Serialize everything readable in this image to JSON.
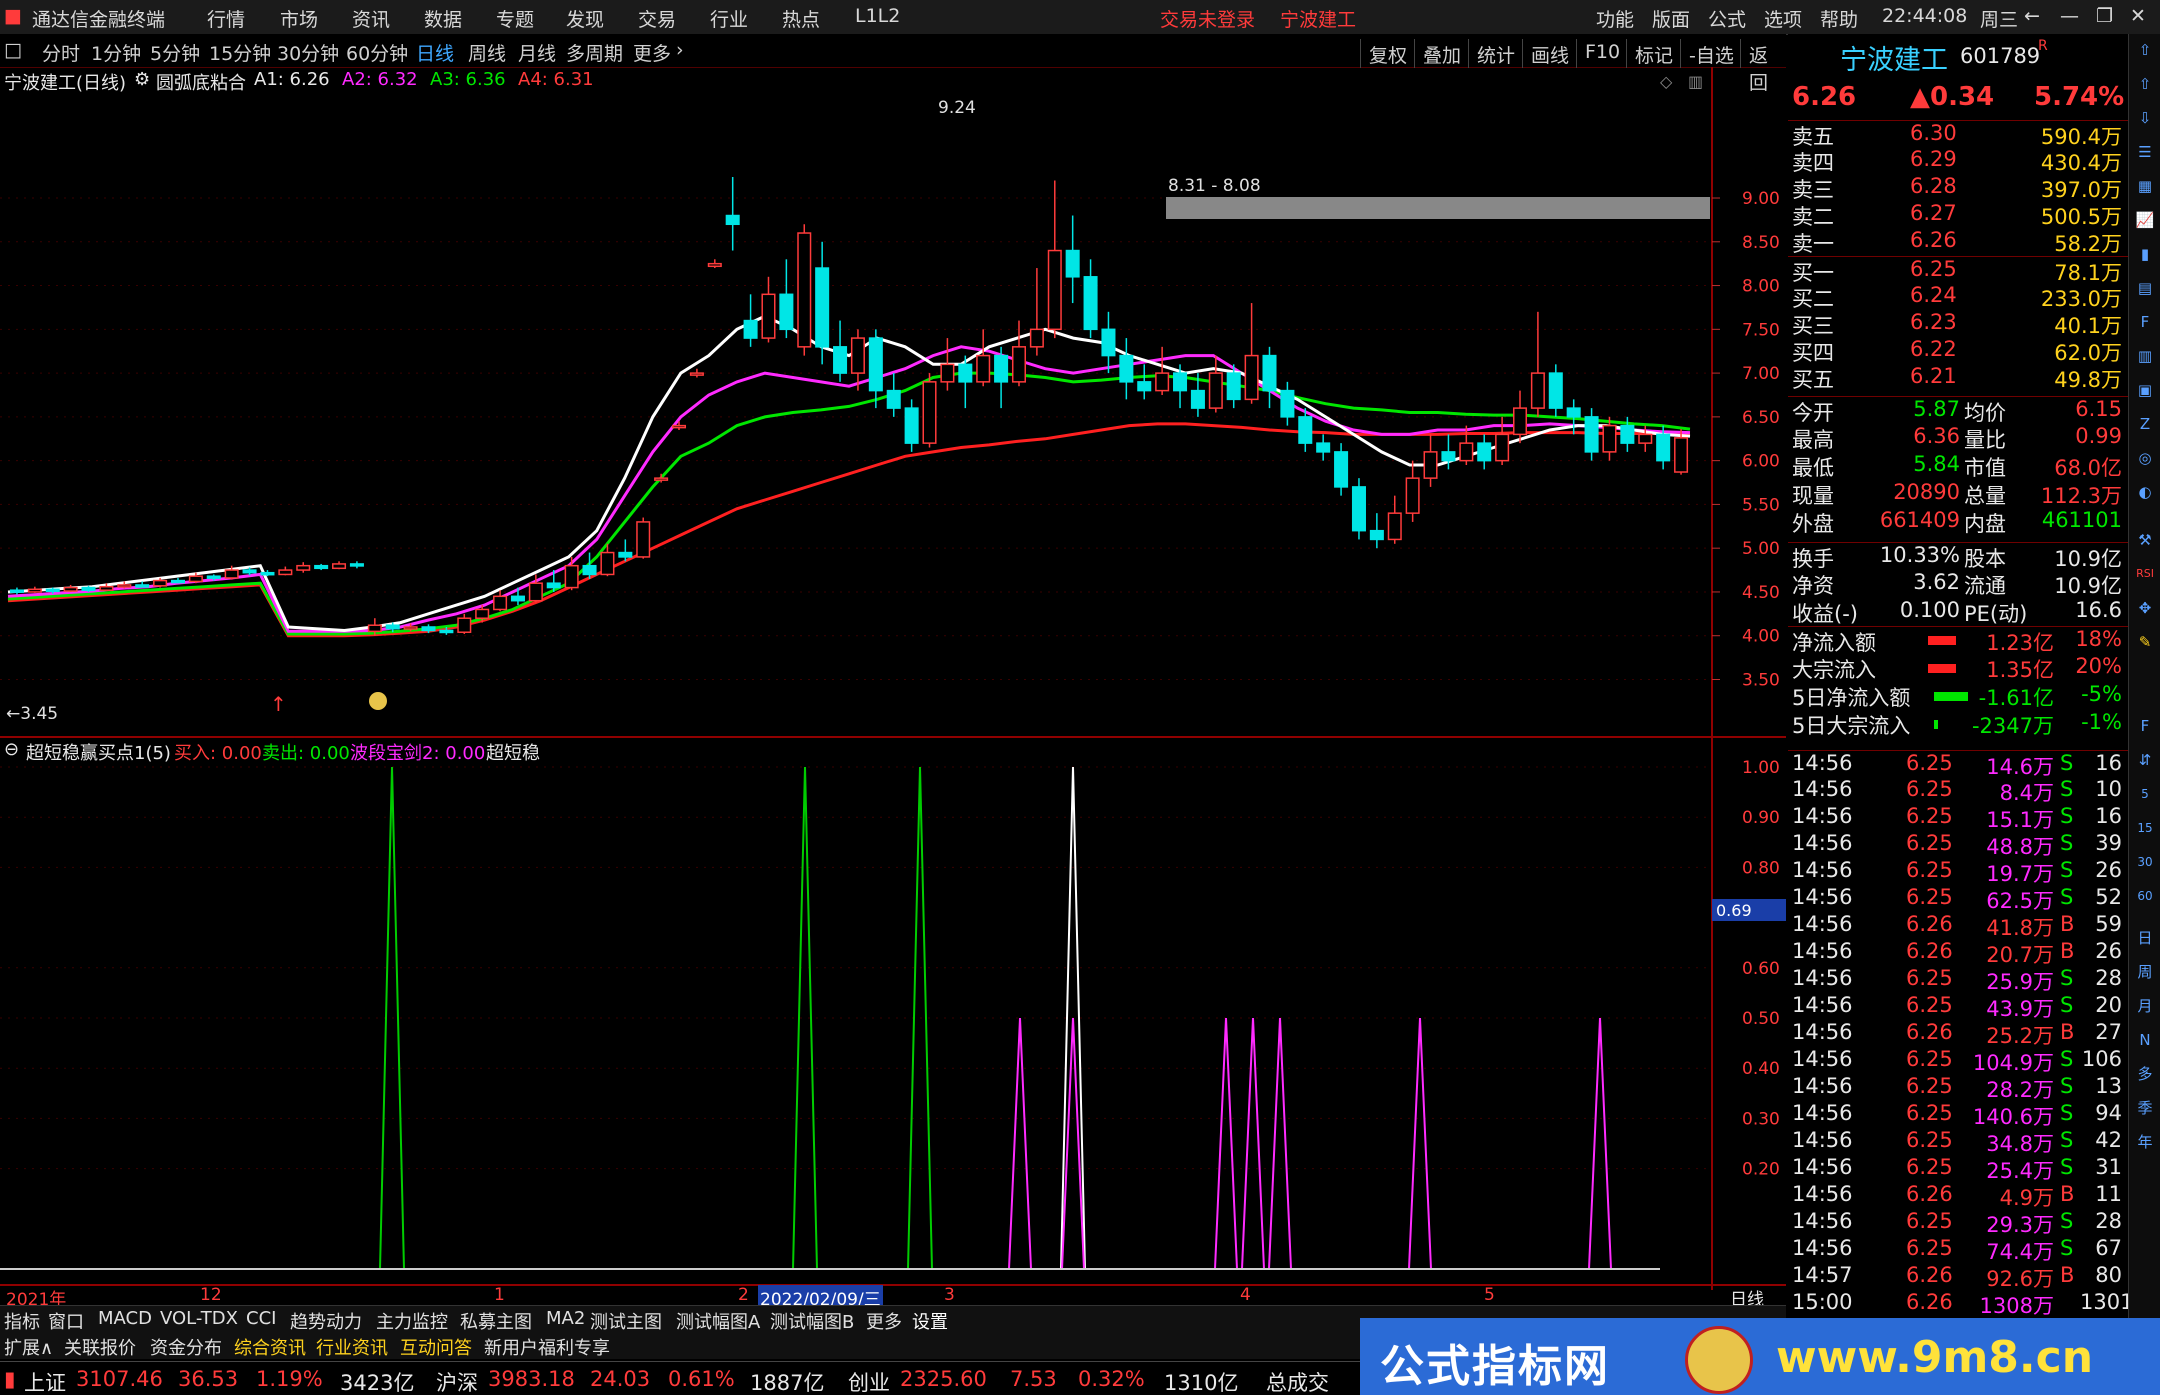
{
  "app": {
    "title": "通达信金融终端",
    "alert": "交易未登录",
    "stock_tab": "宁波建工",
    "clock": "22:44:08",
    "weekday": "周三"
  },
  "menu": [
    "行情",
    "市场",
    "资讯",
    "数据",
    "专题",
    "发现",
    "交易",
    "行业",
    "热点",
    "L1L2"
  ],
  "right_menu": [
    "功能",
    "版面",
    "公式",
    "选项",
    "帮助"
  ],
  "periods": [
    "分时",
    "1分钟",
    "5分钟",
    "15分钟",
    "30分钟",
    "60分钟",
    "日线",
    "周线",
    "月线",
    "多周期",
    "更多"
  ],
  "active_period": "日线",
  "toolbar": [
    "复权",
    "叠加",
    "统计",
    "画线",
    "F10",
    "标记",
    "-自选",
    "返回"
  ],
  "main_indicator": {
    "stock": "宁波建工(日线)",
    "name": "圆弧底粘合",
    "a1": "A1: 6.26",
    "a2": "A2: 6.32",
    "a3": "A3: 6.36",
    "a4": "A4: 6.31"
  },
  "annotations": {
    "high": "9.24",
    "zone": "8.31 - 8.08",
    "low": "3.45"
  },
  "price_axis": [
    "9.00",
    "8.50",
    "8.00",
    "7.50",
    "7.00",
    "6.50",
    "6.00",
    "5.50",
    "5.00",
    "4.50",
    "4.00",
    "3.50"
  ],
  "sub_indicator": {
    "name": "超短稳赢买点1(5)",
    "buy": "买入: 0.00",
    "sell": "卖出: 0.00",
    "wave": "波段宝剑2: 0.00",
    "extra": "超短稳"
  },
  "sub_axis": [
    "1.00",
    "0.90",
    "0.80",
    "0.60",
    "0.50",
    "0.40",
    "0.30",
    "0.20"
  ],
  "sub_cursor": "0.69",
  "date_axis": {
    "y2021": "2021年",
    "m12": "12",
    "m1": "1",
    "m2": "2",
    "selected": "2022/02/09/三",
    "m3": "3",
    "m4": "4",
    "m5": "5",
    "period": "日线"
  },
  "quote": {
    "name": "宁波建工",
    "code": "601789",
    "flag": "R",
    "price": "6.26",
    "change": "▲0.34",
    "pct": "5.74%",
    "asks": [
      [
        "卖五",
        "6.30",
        "590.4万"
      ],
      [
        "卖四",
        "6.29",
        "430.4万"
      ],
      [
        "卖三",
        "6.28",
        "397.0万"
      ],
      [
        "卖二",
        "6.27",
        "500.5万"
      ],
      [
        "卖一",
        "6.26",
        "58.2万"
      ]
    ],
    "bids": [
      [
        "买一",
        "6.25",
        "78.1万"
      ],
      [
        "买二",
        "6.24",
        "233.0万"
      ],
      [
        "买三",
        "6.23",
        "40.1万"
      ],
      [
        "买四",
        "6.22",
        "62.0万"
      ],
      [
        "买五",
        "6.21",
        "49.8万"
      ]
    ],
    "stats": [
      [
        "今开",
        "5.87",
        "均价",
        "6.15"
      ],
      [
        "最高",
        "6.36",
        "量比",
        "0.99"
      ],
      [
        "最低",
        "5.84",
        "市值",
        "68.0亿"
      ],
      [
        "现量",
        "20890",
        "总量",
        "112.3万"
      ],
      [
        "外盘",
        "661409",
        "内盘",
        "461101"
      ],
      [
        "换手",
        "10.33%",
        "股本",
        "10.9亿"
      ],
      [
        "净资",
        "3.62",
        "流通",
        "10.9亿"
      ],
      [
        "收益(-)",
        "0.100",
        "PE(动)",
        "16.6"
      ]
    ],
    "flows": [
      [
        "净流入额",
        "1.23亿",
        "18%"
      ],
      [
        "大宗流入",
        "1.35亿",
        "20%"
      ],
      [
        "5日净流入额",
        "-1.61亿",
        "-5%"
      ],
      [
        "5日大宗流入",
        "-2347万",
        "-1%"
      ]
    ]
  },
  "ticks": [
    [
      "14:56",
      "6.25",
      "14.6万",
      "S",
      "16"
    ],
    [
      "14:56",
      "6.25",
      "8.4万",
      "S",
      "10"
    ],
    [
      "14:56",
      "6.25",
      "15.1万",
      "S",
      "16"
    ],
    [
      "14:56",
      "6.25",
      "48.8万",
      "S",
      "39"
    ],
    [
      "14:56",
      "6.25",
      "19.7万",
      "S",
      "26"
    ],
    [
      "14:56",
      "6.25",
      "62.5万",
      "S",
      "52"
    ],
    [
      "14:56",
      "6.26",
      "41.8万",
      "B",
      "59"
    ],
    [
      "14:56",
      "6.26",
      "20.7万",
      "B",
      "26"
    ],
    [
      "14:56",
      "6.25",
      "25.9万",
      "S",
      "28"
    ],
    [
      "14:56",
      "6.25",
      "43.9万",
      "S",
      "20"
    ],
    [
      "14:56",
      "6.26",
      "25.2万",
      "B",
      "27"
    ],
    [
      "14:56",
      "6.25",
      "104.9万",
      "S",
      "106"
    ],
    [
      "14:56",
      "6.25",
      "28.2万",
      "S",
      "13"
    ],
    [
      "14:56",
      "6.25",
      "140.6万",
      "S",
      "94"
    ],
    [
      "14:56",
      "6.25",
      "34.8万",
      "S",
      "42"
    ],
    [
      "14:56",
      "6.25",
      "25.4万",
      "S",
      "31"
    ],
    [
      "14:56",
      "6.26",
      "4.9万",
      "B",
      "11"
    ],
    [
      "14:56",
      "6.25",
      "29.3万",
      "S",
      "28"
    ],
    [
      "14:56",
      "6.25",
      "74.4万",
      "S",
      "67"
    ],
    [
      "14:57",
      "6.26",
      "92.6万",
      "B",
      "80"
    ],
    [
      "15:00",
      "6.26",
      "1308万",
      "",
      "1301"
    ]
  ],
  "side_labels": [
    "日",
    "周",
    "月",
    "N",
    "多",
    "季",
    "年"
  ],
  "bottom_tabs": [
    "指标",
    "窗口",
    "MACD",
    "VOL-TDX",
    "CCI",
    "趋势动力",
    "主力监控",
    "私募主图",
    "MA2",
    "测试主图",
    "测试幅图A",
    "测试幅图B",
    "更多",
    "设置"
  ],
  "bottom_tabs2": [
    "扩展∧",
    "关联报价",
    "资金分布",
    "综合资讯",
    "行业资讯",
    "互动问答",
    "新用户福利专享"
  ],
  "status": {
    "sh_name": "上证",
    "sh_val": "3107.46",
    "sh_chg": "36.53",
    "sh_pct": "1.19%",
    "sh_amt": "3423亿",
    "sz_name": "沪深",
    "sz_val": "3983.18",
    "sz_chg": "24.03",
    "sz_pct": "0.61%",
    "sz_amt": "1887亿",
    "cy_name": "创业",
    "cy_val": "2325.60",
    "cy_chg": "7.53",
    "cy_pct": "0.32%",
    "cy_amt": "1310亿",
    "total": "总成交"
  },
  "brand": {
    "left": "公式指标网",
    "right": "www.9m8.cn"
  },
  "colors": {
    "up": "#ff3b3b",
    "down": "#00e6e6",
    "ma1": "#ffffff",
    "ma2": "#ff2bff",
    "ma3": "#00e600",
    "ma4": "#ff2020",
    "buy": "#00cc00",
    "wave": "#ff2bff"
  },
  "chart_data": {
    "type": "candlestick",
    "ylim": [
      3.3,
      9.4
    ],
    "candles": [
      [
        4.52,
        4.5,
        4.55,
        4.47
      ],
      [
        4.5,
        4.53,
        4.56,
        4.49
      ],
      [
        4.53,
        4.51,
        4.55,
        4.48
      ],
      [
        4.51,
        4.55,
        4.58,
        4.5
      ],
      [
        4.55,
        4.52,
        4.57,
        4.5
      ],
      [
        4.52,
        4.56,
        4.6,
        4.51
      ],
      [
        4.56,
        4.58,
        4.62,
        4.54
      ],
      [
        4.58,
        4.57,
        4.62,
        4.55
      ],
      [
        4.57,
        4.63,
        4.66,
        4.55
      ],
      [
        4.63,
        4.62,
        4.66,
        4.6
      ],
      [
        4.62,
        4.68,
        4.72,
        4.6
      ],
      [
        4.68,
        4.66,
        4.7,
        4.63
      ],
      [
        4.66,
        4.75,
        4.8,
        4.64
      ],
      [
        4.75,
        4.72,
        4.78,
        4.69
      ],
      [
        4.72,
        4.7,
        4.75,
        4.68
      ],
      [
        4.7,
        4.75,
        4.79,
        4.69
      ],
      [
        4.75,
        4.8,
        4.84,
        4.72
      ],
      [
        4.8,
        4.77,
        4.82,
        4.75
      ],
      [
        4.77,
        4.82,
        4.85,
        4.76
      ],
      [
        4.82,
        4.8,
        4.85,
        4.77
      ],
      [
        4.05,
        4.12,
        4.2,
        4.0
      ],
      [
        4.12,
        4.08,
        4.15,
        4.04
      ],
      [
        4.08,
        4.1,
        4.14,
        4.05
      ],
      [
        4.1,
        4.06,
        4.13,
        4.03
      ],
      [
        4.06,
        4.04,
        4.1,
        4.01
      ],
      [
        4.04,
        4.2,
        4.25,
        4.02
      ],
      [
        4.2,
        4.3,
        4.35,
        4.15
      ],
      [
        4.3,
        4.45,
        4.52,
        4.28
      ],
      [
        4.45,
        4.4,
        4.55,
        4.35
      ],
      [
        4.4,
        4.6,
        4.7,
        4.38
      ],
      [
        4.6,
        4.55,
        4.75,
        4.5
      ],
      [
        4.55,
        4.8,
        4.9,
        4.52
      ],
      [
        4.8,
        4.7,
        4.95,
        4.65
      ],
      [
        4.7,
        4.95,
        5.05,
        4.68
      ],
      [
        4.95,
        4.9,
        5.1,
        4.85
      ],
      [
        4.9,
        5.3,
        5.35,
        4.88
      ],
      [
        5.78,
        5.8,
        5.85,
        5.75
      ],
      [
        6.38,
        6.4,
        6.45,
        6.35
      ],
      [
        6.98,
        7.0,
        7.05,
        6.95
      ],
      [
        8.22,
        8.25,
        8.3,
        8.2
      ],
      [
        8.8,
        8.7,
        9.24,
        8.4
      ],
      [
        7.6,
        7.4,
        7.9,
        7.3
      ],
      [
        7.4,
        7.9,
        8.1,
        7.35
      ],
      [
        7.9,
        7.5,
        8.3,
        7.4
      ],
      [
        7.3,
        8.6,
        8.7,
        7.2
      ],
      [
        8.2,
        7.3,
        8.5,
        7.1
      ],
      [
        7.3,
        7.0,
        7.6,
        6.9
      ],
      [
        7.0,
        7.4,
        7.5,
        6.8
      ],
      [
        7.4,
        6.8,
        7.5,
        6.6
      ],
      [
        6.8,
        6.6,
        7.0,
        6.5
      ],
      [
        6.6,
        6.2,
        6.7,
        6.1
      ],
      [
        6.2,
        6.9,
        7.0,
        6.15
      ],
      [
        6.9,
        7.1,
        7.4,
        6.8
      ],
      [
        7.1,
        6.9,
        7.2,
        6.6
      ],
      [
        6.9,
        7.2,
        7.5,
        6.85
      ],
      [
        7.2,
        6.9,
        7.3,
        6.6
      ],
      [
        6.9,
        7.3,
        7.6,
        6.85
      ],
      [
        7.3,
        7.5,
        8.2,
        7.2
      ],
      [
        7.5,
        8.4,
        9.2,
        7.4
      ],
      [
        8.4,
        8.1,
        8.8,
        7.8
      ],
      [
        8.1,
        7.5,
        8.3,
        7.4
      ],
      [
        7.5,
        7.2,
        7.7,
        7.0
      ],
      [
        7.2,
        6.9,
        7.4,
        6.7
      ],
      [
        6.9,
        6.8,
        7.1,
        6.7
      ],
      [
        6.8,
        7.0,
        7.3,
        6.75
      ],
      [
        7.0,
        6.8,
        7.1,
        6.6
      ],
      [
        6.8,
        6.6,
        7.0,
        6.5
      ],
      [
        6.6,
        7.0,
        7.2,
        6.55
      ],
      [
        7.0,
        6.7,
        7.1,
        6.6
      ],
      [
        6.7,
        7.2,
        7.8,
        6.65
      ],
      [
        7.2,
        6.8,
        7.3,
        6.6
      ],
      [
        6.8,
        6.5,
        6.9,
        6.4
      ],
      [
        6.5,
        6.2,
        6.6,
        6.1
      ],
      [
        6.2,
        6.1,
        6.3,
        6.0
      ],
      [
        6.1,
        5.7,
        6.2,
        5.6
      ],
      [
        5.7,
        5.2,
        5.8,
        5.1
      ],
      [
        5.2,
        5.1,
        5.4,
        5.0
      ],
      [
        5.1,
        5.4,
        5.6,
        5.05
      ],
      [
        5.4,
        5.8,
        6.0,
        5.3
      ],
      [
        5.8,
        6.1,
        6.3,
        5.7
      ],
      [
        6.1,
        6.0,
        6.3,
        5.9
      ],
      [
        6.0,
        6.2,
        6.4,
        5.95
      ],
      [
        6.2,
        6.0,
        6.3,
        5.9
      ],
      [
        6.0,
        6.3,
        6.5,
        5.95
      ],
      [
        6.3,
        6.6,
        6.8,
        6.2
      ],
      [
        6.6,
        7.0,
        7.7,
        6.5
      ],
      [
        7.0,
        6.6,
        7.1,
        6.5
      ],
      [
        6.6,
        6.5,
        6.7,
        6.3
      ],
      [
        6.5,
        6.1,
        6.6,
        6.0
      ],
      [
        6.1,
        6.4,
        6.5,
        6.0
      ],
      [
        6.4,
        6.2,
        6.5,
        6.1
      ],
      [
        6.2,
        6.3,
        6.4,
        6.1
      ],
      [
        6.3,
        6.0,
        6.4,
        5.9
      ],
      [
        5.87,
        6.26,
        6.36,
        5.84
      ]
    ],
    "ma_white": [
      4.5,
      4.52,
      4.54,
      4.56,
      4.6,
      4.64,
      4.68,
      4.72,
      4.76,
      4.8,
      4.1,
      4.08,
      4.06,
      4.1,
      4.15,
      4.25,
      4.35,
      4.45,
      4.6,
      4.75,
      4.9,
      5.2,
      5.8,
      6.5,
      7.0,
      7.2,
      7.5,
      7.65,
      7.5,
      7.3,
      7.2,
      7.4,
      7.3,
      7.1,
      7.1,
      7.3,
      7.4,
      7.5,
      7.4,
      7.35,
      7.2,
      7.1,
      7.0,
      7.05,
      7.0,
      6.85,
      6.7,
      6.5,
      6.3,
      6.1,
      5.95,
      5.95,
      6.05,
      6.15,
      6.25,
      6.35,
      6.4,
      6.4,
      6.35,
      6.3,
      6.28
    ],
    "ma_magenta": [
      4.45,
      4.47,
      4.49,
      4.51,
      4.54,
      4.56,
      4.6,
      4.63,
      4.66,
      4.7,
      4.05,
      4.05,
      4.05,
      4.06,
      4.1,
      4.18,
      4.25,
      4.35,
      4.5,
      4.65,
      4.8,
      5.1,
      5.6,
      6.1,
      6.5,
      6.75,
      6.9,
      7.0,
      6.95,
      6.9,
      6.85,
      6.95,
      7.05,
      7.2,
      7.3,
      7.25,
      7.15,
      7.05,
      7.0,
      7.05,
      7.1,
      7.15,
      7.2,
      7.2,
      7.0,
      6.8,
      6.6,
      6.45,
      6.35,
      6.3,
      6.3,
      6.35,
      6.35,
      6.4,
      6.4,
      6.42,
      6.4,
      6.38,
      6.35,
      6.33,
      6.32
    ],
    "ma_green": [
      4.42,
      4.44,
      4.46,
      4.48,
      4.5,
      4.52,
      4.54,
      4.56,
      4.58,
      4.6,
      4.02,
      4.02,
      4.02,
      4.03,
      4.05,
      4.08,
      4.12,
      4.2,
      4.3,
      4.45,
      4.6,
      4.9,
      5.3,
      5.7,
      6.05,
      6.2,
      6.4,
      6.5,
      6.55,
      6.58,
      6.62,
      6.7,
      6.8,
      6.95,
      7.0,
      7.0,
      6.98,
      6.95,
      6.9,
      6.92,
      6.95,
      6.97,
      6.95,
      6.9,
      6.85,
      6.8,
      6.72,
      6.65,
      6.6,
      6.58,
      6.55,
      6.55,
      6.53,
      6.52,
      6.52,
      6.5,
      6.48,
      6.45,
      6.42,
      6.4,
      6.36
    ],
    "ma_red": [
      4.4,
      4.42,
      4.44,
      4.46,
      4.48,
      4.5,
      4.52,
      4.54,
      4.56,
      4.58,
      4.0,
      4.0,
      4.0,
      4.01,
      4.03,
      4.05,
      4.1,
      4.18,
      4.28,
      4.4,
      4.55,
      4.7,
      4.85,
      5.0,
      5.15,
      5.3,
      5.45,
      5.55,
      5.65,
      5.75,
      5.85,
      5.95,
      6.05,
      6.1,
      6.15,
      6.18,
      6.22,
      6.25,
      6.3,
      6.35,
      6.4,
      6.42,
      6.42,
      6.4,
      6.38,
      6.35,
      6.33,
      6.32,
      6.3,
      6.3,
      6.3,
      6.3,
      6.31,
      6.31,
      6.32,
      6.32,
      6.32,
      6.31,
      6.31,
      6.31,
      6.31
    ],
    "signals": [
      {
        "series": "超短稳赢",
        "x": 392,
        "value": 1.0,
        "color": "#00cc00"
      },
      {
        "series": "超短稳赢",
        "x": 805,
        "value": 1.0,
        "color": "#00cc00"
      },
      {
        "series": "超短稳赢",
        "x": 920,
        "value": 1.0,
        "color": "#00cc00"
      },
      {
        "series": "波段宝剑",
        "x": 1020,
        "value": 0.5,
        "color": "#ff2bff"
      },
      {
        "series": "超短稳赢",
        "x": 1073,
        "value": 1.0,
        "color": "#ffffff"
      },
      {
        "series": "波段宝剑",
        "x": 1073,
        "value": 0.5,
        "color": "#ff2bff"
      },
      {
        "series": "波段宝剑",
        "x": 1226,
        "value": 0.5,
        "color": "#ff2bff"
      },
      {
        "series": "波段宝剑",
        "x": 1253,
        "value": 0.5,
        "color": "#ff2bff"
      },
      {
        "series": "波段宝剑",
        "x": 1280,
        "value": 0.5,
        "color": "#ff2bff"
      },
      {
        "series": "波段宝剑",
        "x": 1420,
        "value": 0.5,
        "color": "#ff2bff"
      },
      {
        "series": "波段宝剑",
        "x": 1600,
        "value": 0.5,
        "color": "#ff2bff"
      }
    ]
  }
}
